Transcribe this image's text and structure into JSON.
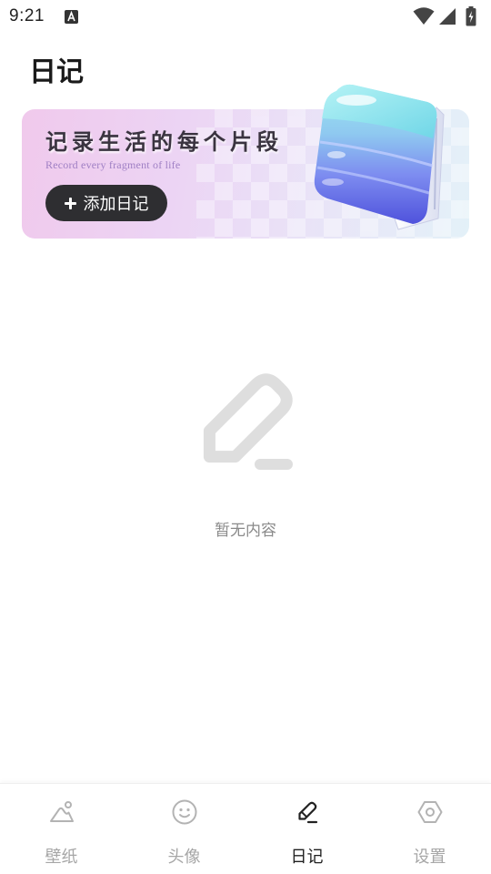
{
  "status_bar": {
    "time": "9:21",
    "icons": [
      "text-a-icon",
      "wifi-icon",
      "signal-icon",
      "battery-icon"
    ]
  },
  "header": {
    "title": "日记"
  },
  "banner": {
    "headline": "记录生活的每个片段",
    "subtitle": "Record every fragment of life",
    "button_label": "添加日记",
    "button_icon": "plus-icon"
  },
  "empty_state": {
    "icon": "pencil-icon",
    "message": "暂无内容"
  },
  "bottom_nav": {
    "items": [
      {
        "label": "壁纸",
        "icon": "mountain-icon",
        "active": false
      },
      {
        "label": "头像",
        "icon": "smiley-icon",
        "active": false
      },
      {
        "label": "日记",
        "icon": "pencil-icon",
        "active": true
      },
      {
        "label": "设置",
        "icon": "hexagon-settings-icon",
        "active": false
      }
    ]
  },
  "colors": {
    "active_nav": "#1f1f1f",
    "inactive_nav": "#a6a6a6",
    "button_bg": "#2e2e31",
    "subtitle": "#9f7fc4",
    "empty_icon": "#dedede",
    "empty_text": "#8a8a8a"
  }
}
